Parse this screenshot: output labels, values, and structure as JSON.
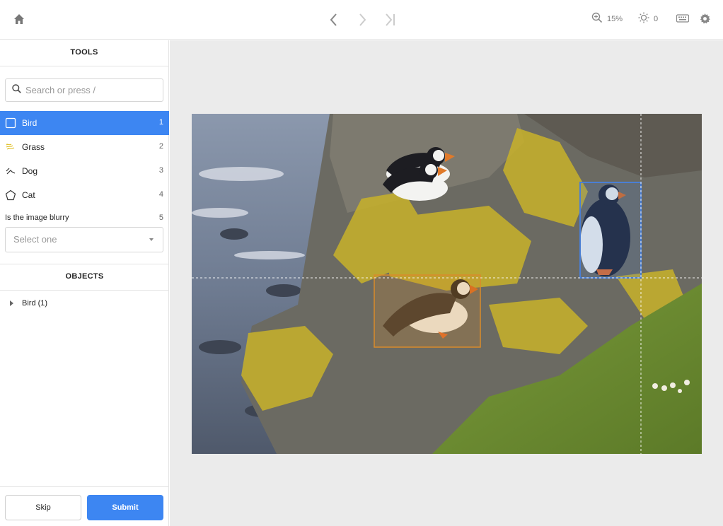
{
  "topbar": {
    "zoom": "15%",
    "brightness": "0"
  },
  "sidebar": {
    "tools_title": "TOOLS",
    "search_placeholder": "Search or press /",
    "tools": [
      {
        "label": "Bird",
        "hotkey": "1",
        "icon": "bbox-icon",
        "active": true
      },
      {
        "label": "Grass",
        "hotkey": "2",
        "icon": "brush-icon"
      },
      {
        "label": "Dog",
        "hotkey": "3",
        "icon": "polyline-icon"
      },
      {
        "label": "Cat",
        "hotkey": "4",
        "icon": "polygon-icon"
      }
    ],
    "question": {
      "label": "Is the image blurry",
      "hotkey": "5",
      "placeholder": "Select one"
    },
    "objects_title": "OBJECTS",
    "objects": [
      {
        "label": "Bird (1)"
      }
    ],
    "skip_label": "Skip",
    "submit_label": "Submit"
  },
  "colors": {
    "accent": "#3d86f2",
    "box_blue": "#4a7fd4",
    "box_orange": "#d98b2b"
  }
}
